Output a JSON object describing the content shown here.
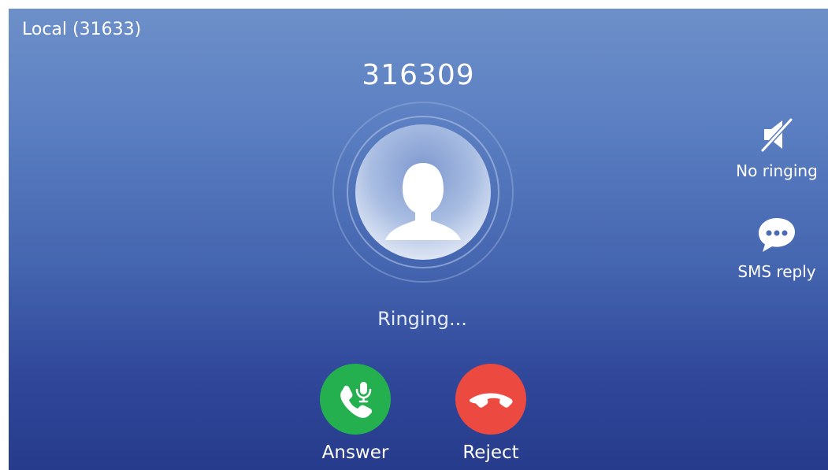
{
  "header": {
    "account": "Local (31633)"
  },
  "call": {
    "caller_number": "316309",
    "status": "Ringing..."
  },
  "side_actions": [
    {
      "label": "No ringing",
      "icon": "mute-speaker-icon"
    },
    {
      "label": "SMS reply",
      "icon": "chat-bubble-icon"
    }
  ],
  "buttons": {
    "answer": {
      "label": "Answer",
      "icon": "phone-microphone-icon",
      "color": "#25b04f"
    },
    "reject": {
      "label": "Reject",
      "icon": "hang-up-icon",
      "color": "#ec4a40"
    }
  }
}
